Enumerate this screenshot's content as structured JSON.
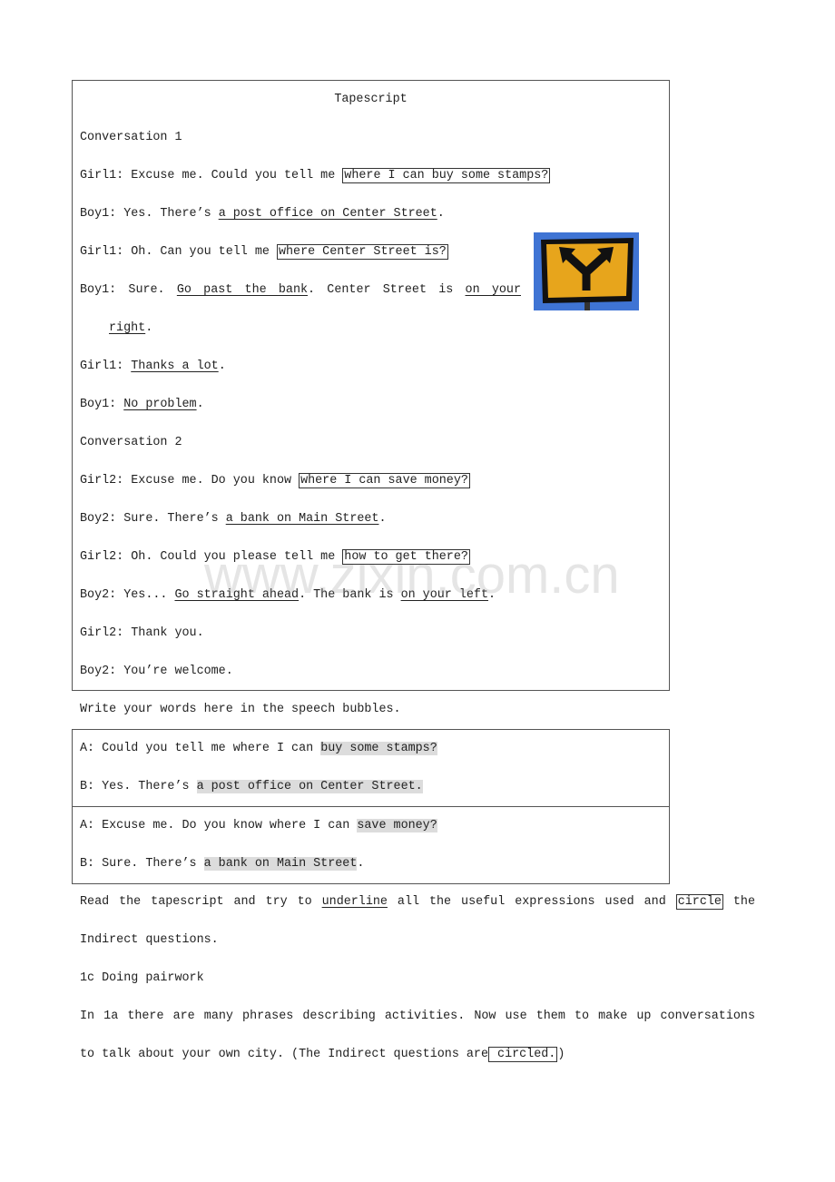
{
  "tapescript": {
    "title": "Tapescript",
    "lines": [
      [
        {
          "t": "Conversation 1"
        }
      ],
      [
        {
          "t": "Girl1: Excuse me. Could you tell me "
        },
        {
          "t": "where I can buy some stamps?",
          "s": "box"
        }
      ],
      [
        {
          "t": "Boy1: Yes. There’s "
        },
        {
          "t": "a post office on Center Street",
          "s": "u"
        },
        {
          "t": "."
        }
      ],
      [
        {
          "t": "Girl1: Oh. Can you tell me "
        },
        {
          "t": "where Center Street is?",
          "s": "box"
        }
      ],
      [
        {
          "t": "Boy1: Sure. "
        },
        {
          "t": "Go past the bank",
          "s": "u"
        },
        {
          "t": ". Center Street is "
        },
        {
          "t": "on your",
          "s": "u"
        }
      ],
      [
        {
          "t": "right",
          "s": "u"
        },
        {
          "t": "."
        }
      ],
      [
        {
          "t": "Girl1: "
        },
        {
          "t": "Thanks a lot",
          "s": "u"
        },
        {
          "t": "."
        }
      ],
      [
        {
          "t": "Boy1: "
        },
        {
          "t": "No problem",
          "s": "u"
        },
        {
          "t": "."
        }
      ],
      [
        {
          "t": "Conversation 2"
        }
      ],
      [
        {
          "t": "Girl2: Excuse me. Do you know "
        },
        {
          "t": "where I can save money?",
          "s": "box"
        }
      ],
      [
        {
          "t": "Boy2: Sure. There’s "
        },
        {
          "t": "a bank on Main Street",
          "s": "u"
        },
        {
          "t": "."
        }
      ],
      [
        {
          "t": "Girl2: Oh. Could you please tell me "
        },
        {
          "t": "how to get there?",
          "s": "box"
        }
      ],
      [
        {
          "t": "Boy2: Yes... "
        },
        {
          "t": "Go straight ahead",
          "s": "u"
        },
        {
          "t": ". The bank is "
        },
        {
          "t": "on your left",
          "s": "u"
        },
        {
          "t": "."
        }
      ],
      [
        {
          "t": "Girl2: Thank you."
        }
      ],
      [
        {
          "t": "Boy2: You’re welcome."
        }
      ]
    ],
    "image_icon": "fork-road-sign"
  },
  "intro": "Write your words here in the speech bubbles.",
  "bubbles": [
    [
      [
        {
          "t": "A: Could you tell me where I can "
        },
        {
          "t": "buy some stamps?",
          "s": "hl"
        }
      ],
      [
        {
          "t": "B: Yes. There’s "
        },
        {
          "t": "a post office on Center Street.",
          "s": "hl"
        }
      ]
    ],
    [
      [
        {
          "t": "A: Excuse me. Do you know where I can "
        },
        {
          "t": "save money?",
          "s": "hl"
        }
      ],
      [
        {
          "t": "B: Sure. There’s "
        },
        {
          "t": "a bank on Main Street",
          "s": "hl"
        },
        {
          "t": "."
        }
      ]
    ]
  ],
  "tail": [
    [
      {
        "t": "Read the tapescript and try to "
      },
      {
        "t": "underline",
        "s": "u"
      },
      {
        "t": " all the useful expressions used and "
      },
      {
        "t": "circle",
        "s": "box"
      },
      {
        "t": " the"
      }
    ],
    [
      {
        "t": "Indirect questions."
      }
    ],
    [
      {
        "t": "1c Doing pairwork"
      }
    ],
    [
      {
        "t": "In 1a there are many phrases describing activities. Now use them to make up conversations"
      }
    ],
    [
      {
        "t": "to talk about your own city. (The Indirect questions are"
      },
      {
        "t": " circled.",
        "s": "box"
      },
      {
        "t": ")"
      }
    ]
  ],
  "watermark": "www.zixin.com.cn"
}
